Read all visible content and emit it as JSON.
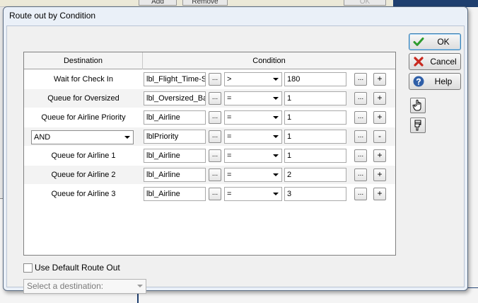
{
  "background": {
    "top_buttons": [
      "Add",
      "Remove"
    ],
    "ok_ghost": "OK"
  },
  "dialog": {
    "title": "Route out by Condition"
  },
  "grid": {
    "headers": {
      "destination": "Destination",
      "condition": "Condition"
    },
    "rows": [
      {
        "destination": "Wait for Check In",
        "label": "lbl_Flight_Time-Si",
        "operator": ">",
        "value": "180",
        "action": "+"
      },
      {
        "destination": "Queue for Oversized",
        "label": "lbl_Oversized_Ba",
        "operator": "=",
        "value": "1",
        "action": "+"
      },
      {
        "destination": "Queue for Airline Priority",
        "label": "lbl_Airline",
        "operator": "=",
        "value": "1",
        "action": "+"
      },
      {
        "destination_select": "AND",
        "label": "lblPriority",
        "operator": "=",
        "value": "1",
        "action": "-"
      },
      {
        "destination": "Queue for Airline 1",
        "label": "lbl_Airline",
        "operator": "=",
        "value": "1",
        "action": "+"
      },
      {
        "destination": "Queue for Airline 2",
        "label": "lbl_Airline",
        "operator": "=",
        "value": "2",
        "action": "+"
      },
      {
        "destination": "Queue for Airline 3",
        "label": "lbl_Airline",
        "operator": "=",
        "value": "3",
        "action": "+"
      }
    ],
    "dots": "..."
  },
  "buttons": {
    "ok": "OK",
    "cancel": "Cancel",
    "help": "Help"
  },
  "bottom": {
    "use_default_label": "Use Default Route Out",
    "use_default_checked": false,
    "destination_placeholder": "Select a destination:"
  },
  "colors": {
    "ok_check": "#2e9b2e",
    "cancel_x": "#c8281e",
    "help_circle": "#2f5fa8"
  },
  "icons": [
    "check-icon",
    "cancel-x-icon",
    "help-icon",
    "hand-up-icon",
    "hand-down-icon"
  ]
}
